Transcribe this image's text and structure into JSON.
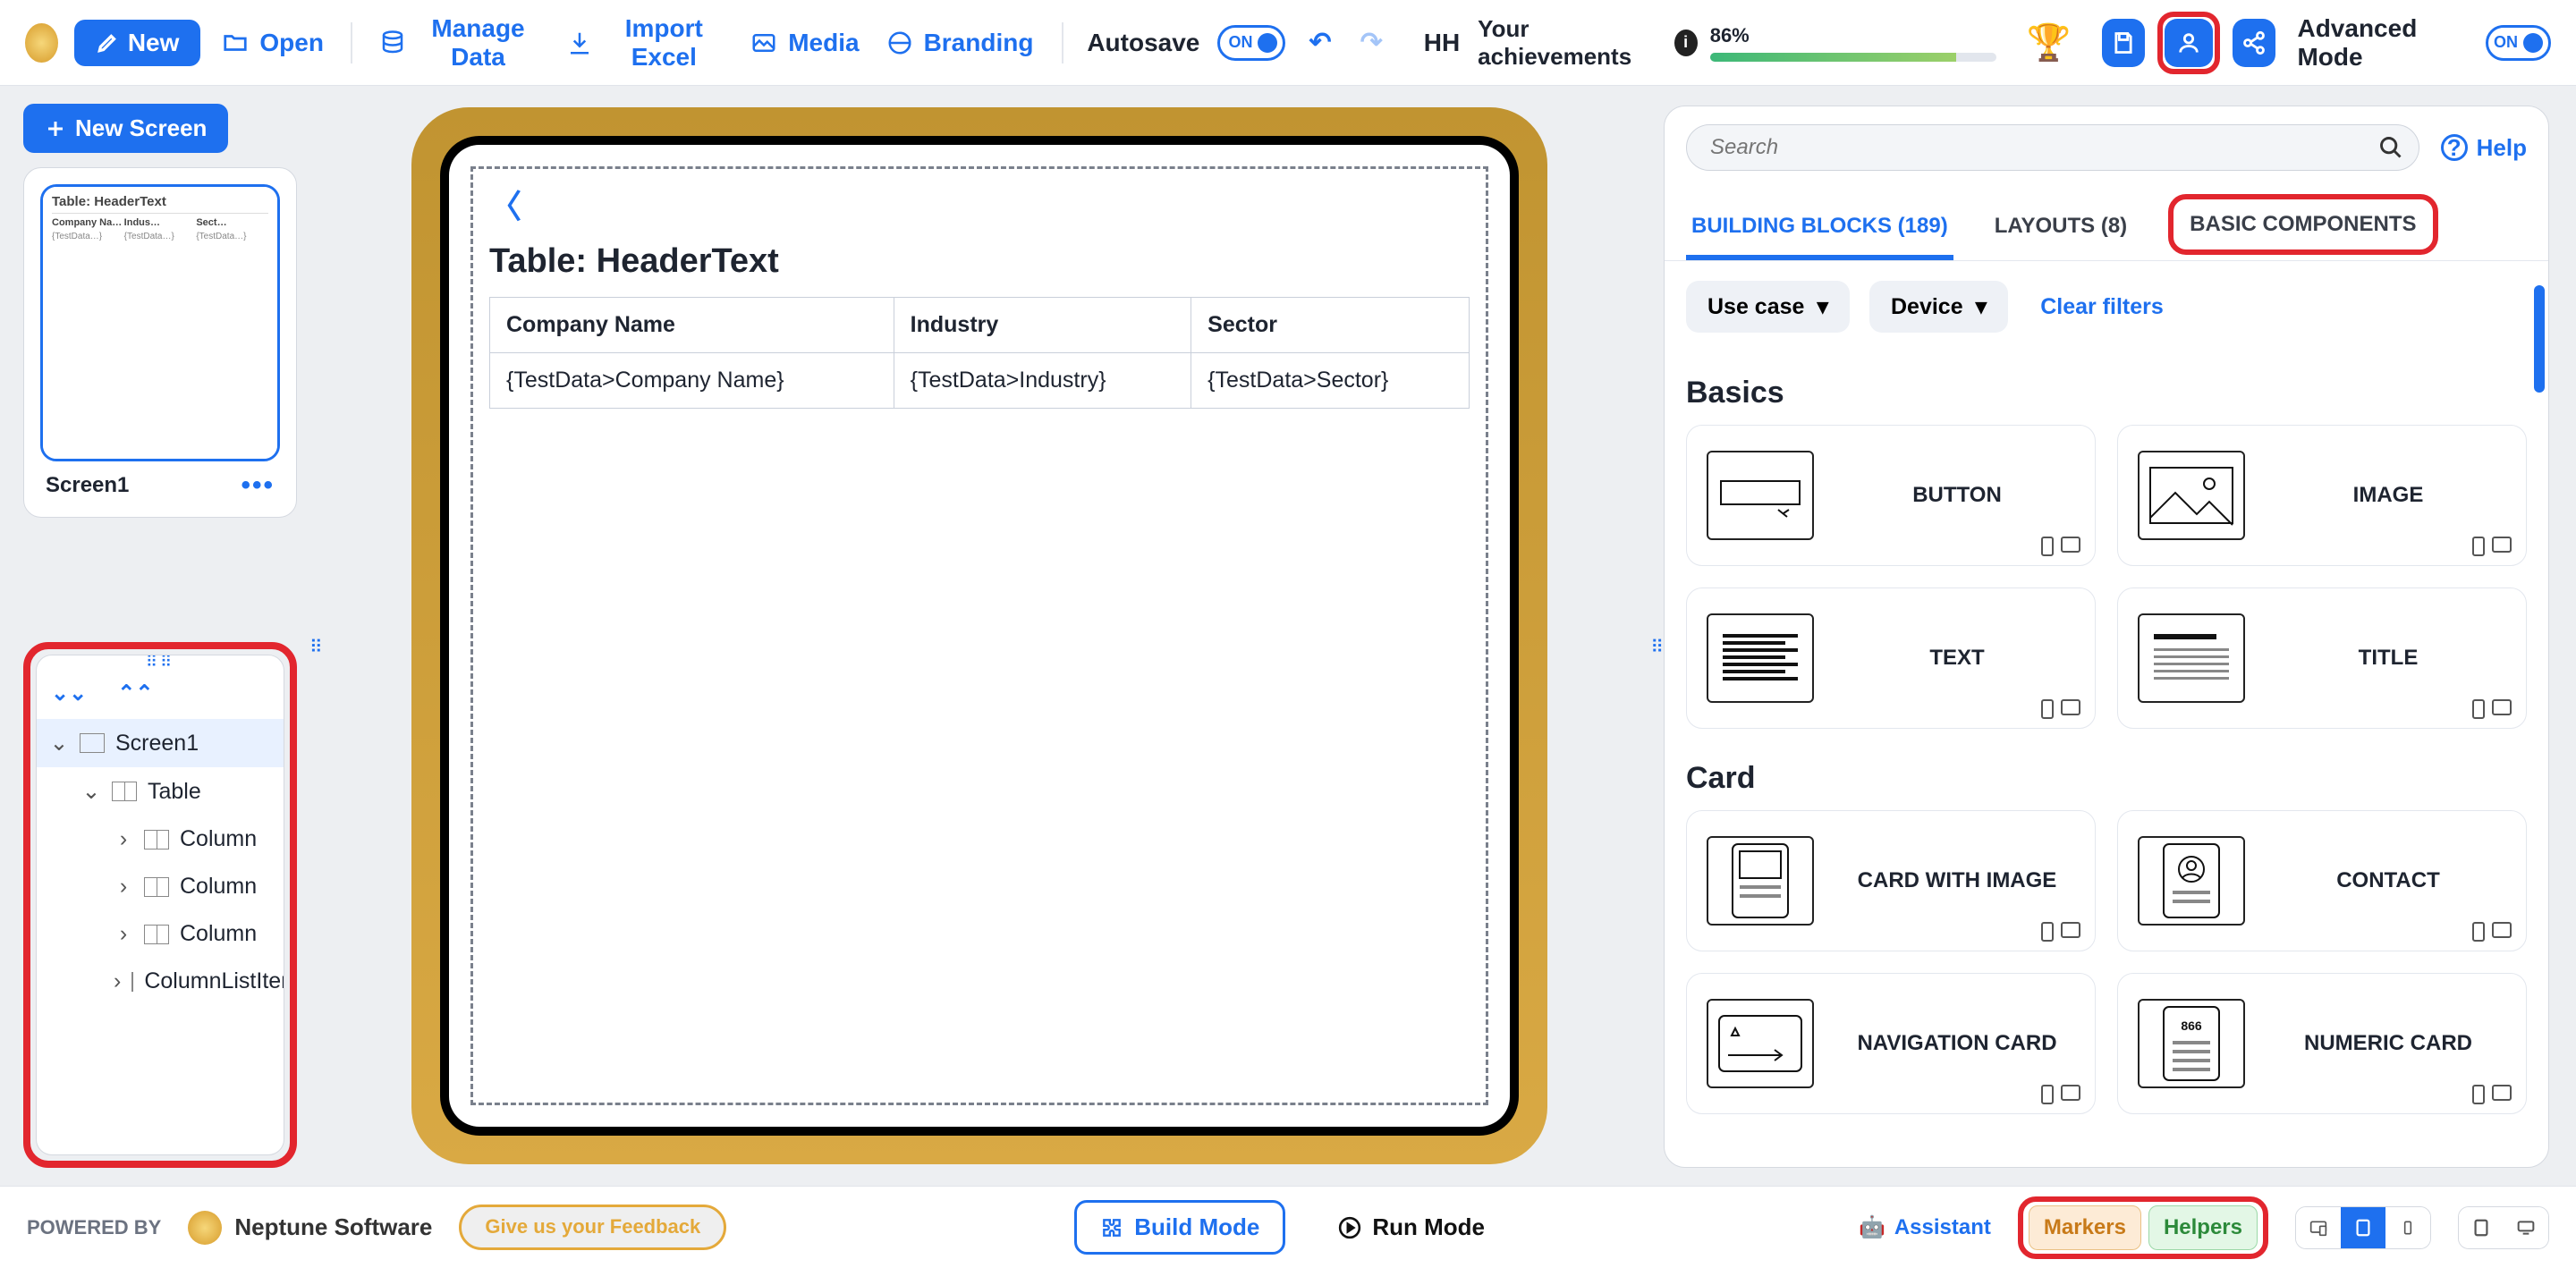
{
  "toolbar": {
    "new": "New",
    "open": "Open",
    "manage_data": "Manage Data",
    "import_excel": "Import Excel",
    "media": "Media",
    "branding": "Branding",
    "autosave_label": "Autosave",
    "autosave_state": "ON",
    "user_initials": "HH",
    "ach_label": "Your achievements",
    "ach_pct": "86%",
    "advanced_label": "Advanced Mode",
    "advanced_state": "ON"
  },
  "left": {
    "new_screen": "New Screen",
    "screen_name": "Screen1",
    "thumb_title": "Table: HeaderText",
    "tree": [
      {
        "label": "Screen1",
        "sel": true,
        "icon": "screen",
        "depth": 0,
        "exp": true
      },
      {
        "label": "Table",
        "icon": "table",
        "depth": 1,
        "exp": true
      },
      {
        "label": "Column",
        "icon": "col",
        "depth": 2,
        "exp": false
      },
      {
        "label": "Column",
        "icon": "col",
        "depth": 2,
        "exp": false
      },
      {
        "label": "Column",
        "icon": "col",
        "depth": 2,
        "exp": false
      },
      {
        "label": "ColumnListItem",
        "icon": "row",
        "depth": 2,
        "exp": false
      }
    ]
  },
  "canvas": {
    "title": "Table: HeaderText",
    "columns": [
      "Company Name",
      "Industry",
      "Sector"
    ],
    "row": [
      "{TestData>Company Name}",
      "{TestData>Industry}",
      "{TestData>Sector}"
    ]
  },
  "right": {
    "search_placeholder": "Search",
    "help": "Help",
    "tabs": {
      "building": "BUILDING BLOCKS (189)",
      "layouts": "LAYOUTS (8)",
      "basic": "BASIC COMPONENTS"
    },
    "filter_usecase": "Use case",
    "filter_device": "Device",
    "clear_filters": "Clear filters",
    "section_basics": "Basics",
    "section_card": "Card",
    "cards_basics": [
      "BUTTON",
      "IMAGE",
      "TEXT",
      "TITLE"
    ],
    "cards_card": [
      "CARD WITH IMAGE",
      "CONTACT",
      "NAVIGATION CARD",
      "NUMERIC CARD"
    ],
    "numeric_card_value": "866"
  },
  "bottom": {
    "powered": "POWERED BY",
    "brand": "Neptune Software",
    "feedback": "Give us your Feedback",
    "build": "Build Mode",
    "run": "Run Mode",
    "assistant": "Assistant",
    "markers": "Markers",
    "helpers": "Helpers"
  }
}
